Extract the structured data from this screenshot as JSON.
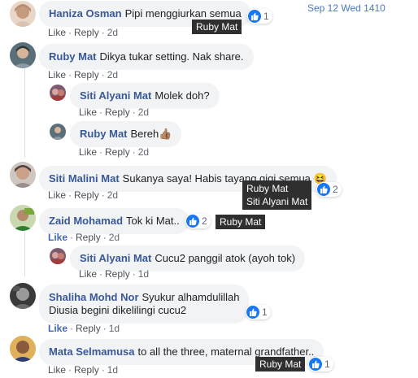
{
  "timestamp": "Sep 12 Wed 1410",
  "actions": {
    "like": "Like",
    "reply": "Reply",
    "dot": "·"
  },
  "comments": [
    {
      "name": "Haniza Osman",
      "text": "Pipi menggiurkan semua",
      "time": "2d",
      "reactions": "1",
      "tooltip": [
        "Ruby Mat"
      ]
    },
    {
      "name": "Ruby Mat",
      "text": "Dikya tukar setting. Nak share.",
      "time": "2d"
    },
    {
      "name": "Siti Alyani Mat",
      "text": "Molek doh?",
      "time": "2d"
    },
    {
      "name": "Ruby Mat",
      "text": "Bereh",
      "emoji": "👍🏽",
      "time": "2d"
    },
    {
      "name": "Siti Malini Mat",
      "text": "Sukanya saya! Habis tayang gigi semua",
      "emoji": "😆",
      "time": "2d",
      "reactions": "2",
      "tooltip": [
        "Ruby Mat",
        "Siti Alyani Mat"
      ]
    },
    {
      "name": "Zaid Mohamad",
      "text": "Tok ki Mat..",
      "time": "2d",
      "reactions": "2",
      "tooltip": [
        "Ruby Mat"
      ]
    },
    {
      "name": "Siti Alyani Mat",
      "text": "Cucu2 panggil atok (ayoh tok)",
      "time": "1d"
    },
    {
      "name": "Shaliha Mohd Nor",
      "text": "Syukur alhamdulillah",
      "text2": "Diusia begini dikelilingi cucu2",
      "time": "1d",
      "reactions": "1"
    },
    {
      "name": "Mata Selmamusa",
      "text": "to all the three, maternal grandfather..",
      "time": "1d",
      "reactions": "1",
      "tooltip": [
        "Ruby Mat"
      ]
    }
  ],
  "colors": {
    "name": "#385898",
    "bubble": "#f2f3f5",
    "like_blue": "#1877f2",
    "tooltip_bg": "#2f2f2f",
    "timestamp": "#4a78c2"
  }
}
